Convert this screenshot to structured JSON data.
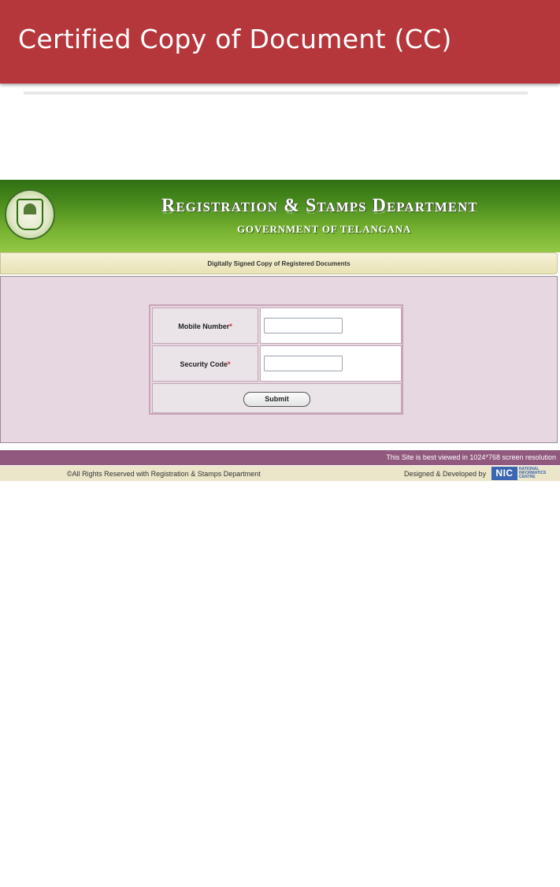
{
  "appbar": {
    "title": "Certified Copy of Document (CC)"
  },
  "header": {
    "title": "Registration & Stamps Department",
    "subtitle": "GOVERNMENT OF TELANGANA",
    "emblem": "telangana-emblem-icon"
  },
  "subheader": {
    "text": "Digitally Signed Copy of Registered Documents"
  },
  "form": {
    "mobile_label": "Mobile Number",
    "security_label": "Security Code",
    "required_marker": "*",
    "mobile_value": "",
    "security_value": "",
    "submit_label": "Submit"
  },
  "resolution_note": "This Site is best viewed in 1024*768 screen resolution",
  "footer": {
    "copyright": "©All Rights Reserved with Registration & Stamps Department",
    "credit": "Designed & Developed by",
    "nic_logo": {
      "mark": "NIC",
      "lines": [
        "NATIONAL",
        "INFORMATICS",
        "CENTRE"
      ]
    }
  },
  "colors": {
    "appbar": "#b5363b",
    "header_green": "#4d8f1f",
    "panel": "#e6d7e1",
    "resolution_bar": "#91597e",
    "footer": "#ebe5c9"
  }
}
